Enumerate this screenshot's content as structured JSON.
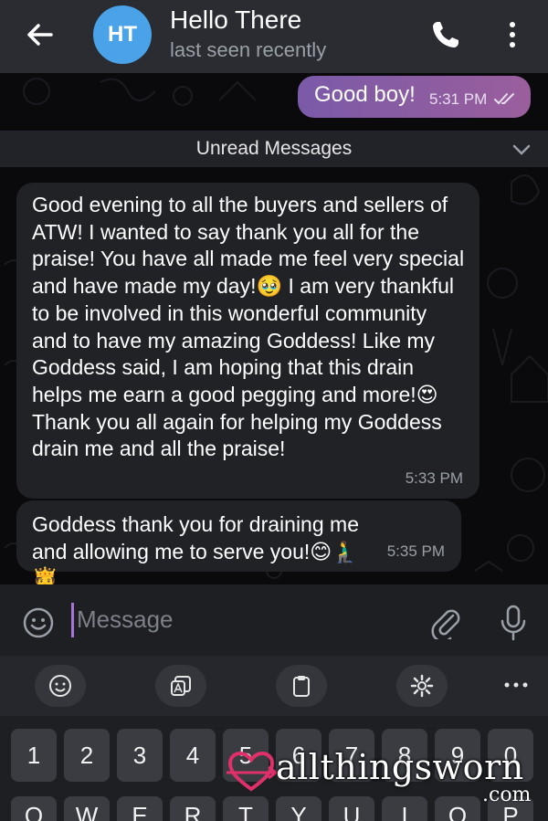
{
  "header": {
    "avatar_initials": "HT",
    "title": "Hello There",
    "subtitle": "last seen recently",
    "back_icon": "arrow-left-icon",
    "call_icon": "phone-icon",
    "menu_icon": "more-vertical-icon"
  },
  "messages": {
    "outgoing": {
      "text": "Good boy!",
      "time": "5:31 PM",
      "status_icon": "double-check-icon"
    },
    "unread_label": "Unread Messages",
    "incoming": [
      {
        "text": "Good evening to all the buyers and sellers of ATW! I wanted to say thank you all for the praise! You have all made me feel very special and have made my day!🥹 I am very thankful to be involved in this wonderful community and to have my amazing Goddess! Like my Goddess said, I am hoping that this drain helps me earn a good pegging and more!😍 Thank you all again for helping my Goddess drain me and all the praise!",
        "time": "5:33 PM"
      },
      {
        "text": "Goddess thank you for draining me and allowing me to serve you!😊🧎‍♂️🫅",
        "time": "5:35 PM"
      }
    ]
  },
  "composer": {
    "placeholder": "Message",
    "emoji_icon": "smiley-icon",
    "attach_icon": "paperclip-icon",
    "mic_icon": "microphone-icon"
  },
  "keyboard": {
    "toolbar_icons": [
      "emoji-icon",
      "sticker-icon",
      "clipboard-icon",
      "settings-icon",
      "more-horizontal-icon"
    ],
    "number_row": [
      "1",
      "2",
      "3",
      "4",
      "5",
      "6",
      "7",
      "8",
      "9",
      "0"
    ],
    "letter_row": [
      "Q",
      "W",
      "E",
      "R",
      "T",
      "Y",
      "U",
      "I",
      "O",
      "P"
    ]
  },
  "watermark": {
    "text": "allthingsworn",
    "suffix": ".com"
  },
  "colors": {
    "header_bg": "#2a2c31",
    "outgoing_bubble": "#8a5ca3",
    "incoming_bubble": "#202226",
    "avatar": "#4aa3e8",
    "cursor": "#a974d8"
  }
}
